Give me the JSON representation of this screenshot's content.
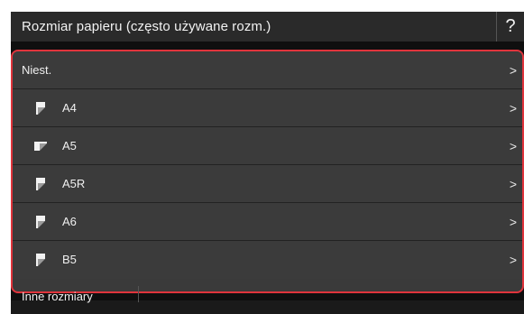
{
  "header": {
    "title": "Rozmiar papieru (często używane rozm.)",
    "help_label": "?"
  },
  "list": {
    "items": [
      {
        "label": "Niest.",
        "icon": "none"
      },
      {
        "label": "A4",
        "icon": "paper-portrait-icon"
      },
      {
        "label": "A5",
        "icon": "paper-landscape-icon"
      },
      {
        "label": "A5R",
        "icon": "paper-portrait-icon"
      },
      {
        "label": "A6",
        "icon": "paper-portrait-icon"
      },
      {
        "label": "B5",
        "icon": "paper-portrait-icon"
      }
    ],
    "chevron": ">",
    "highlight_color": "#e0343c"
  },
  "footer": {
    "other_sizes_label": "Inne rozmiary"
  }
}
